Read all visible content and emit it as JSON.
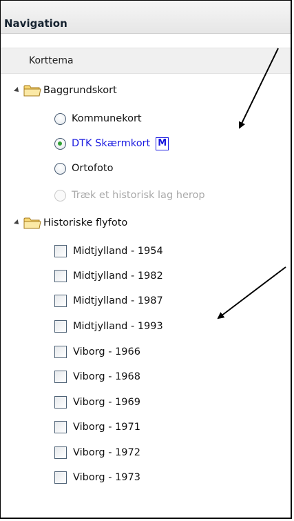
{
  "panel": {
    "title": "Navigation",
    "section_label": "Korttema"
  },
  "groups": [
    {
      "label": "Baggrundskort",
      "items": [
        {
          "label": "Kommunekort",
          "selected": false,
          "disabled": false
        },
        {
          "label": "DTK Skærmkort",
          "selected": true,
          "disabled": false,
          "badge": "M"
        },
        {
          "label": "Ortofoto",
          "selected": false,
          "disabled": false
        },
        {
          "label": "Træk et historisk lag herop",
          "selected": false,
          "disabled": true
        }
      ]
    },
    {
      "label": "Historiske flyfoto",
      "items": [
        {
          "label": "Midtjylland - 1954",
          "checked": false
        },
        {
          "label": "Midtjylland - 1982",
          "checked": false
        },
        {
          "label": "Midtjylland - 1987",
          "checked": false
        },
        {
          "label": "Midtjylland - 1993",
          "checked": false
        },
        {
          "label": "Viborg - 1966",
          "checked": false
        },
        {
          "label": "Viborg - 1968",
          "checked": false
        },
        {
          "label": "Viborg - 1969",
          "checked": false
        },
        {
          "label": "Viborg - 1971",
          "checked": false
        },
        {
          "label": "Viborg - 1972",
          "checked": false
        },
        {
          "label": "Viborg - 1973",
          "checked": false
        }
      ]
    }
  ],
  "colors": {
    "selected_text": "#1a1ae0",
    "disabled_text": "#a9a9a9",
    "radio_dot": "#2fa033",
    "folder_fill": "#f7d774"
  }
}
